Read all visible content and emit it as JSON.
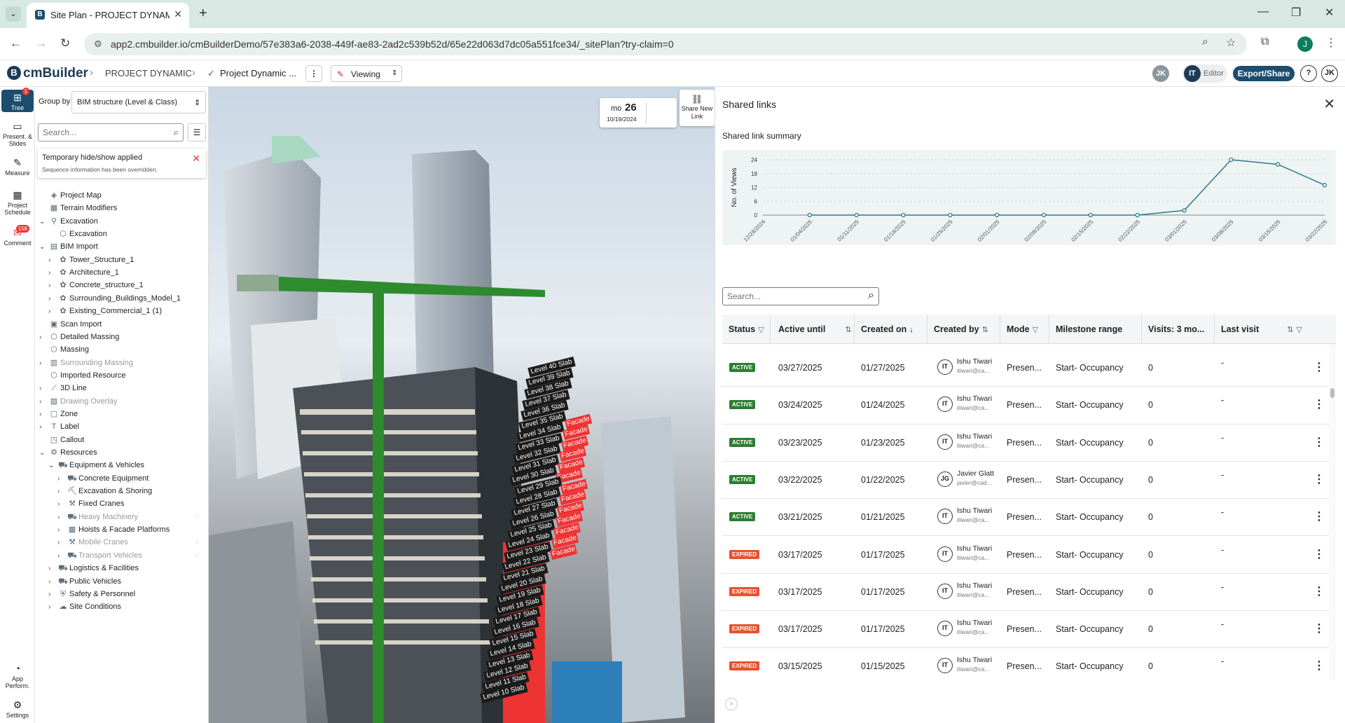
{
  "browser": {
    "tab_title": "Site Plan - PROJECT DYNAMIC",
    "url": "app2.cmbuilder.io/cmBuilderDemo/57e383a6-2038-449f-ae83-2ad2c539b52d/65e22d063d7dc05a551fce34/_sitePlan?try-claim=0",
    "profile_initial": "J"
  },
  "header": {
    "logo": "cmBuilder",
    "crumb1": "PROJECT DYNAMIC",
    "crumb2": "Project Dynamic ...",
    "mode": "Viewing",
    "user1": "JK",
    "editor_initials": "IT",
    "editor_label": "Editor",
    "export_label": "Export/Share",
    "help": "?",
    "user2": "JK"
  },
  "rail": {
    "tree": "Tree",
    "tree_badge": "1",
    "present": "Present. & Slides",
    "measure": "Measure",
    "schedule": "Project Schedule",
    "comment": "Comment",
    "comment_badge": "158",
    "perform": "App Perform.",
    "settings": "Settings"
  },
  "panel": {
    "group_by_label": "Group by",
    "group_by_value": "BIM structure (Level & Class)",
    "search_placeholder": "Search...",
    "notice_title": "Temporary hide/show applied",
    "notice_sub": "Sequence information has been overridden.",
    "tree": [
      {
        "label": "Project Map",
        "depth": 0,
        "chev": "",
        "icon": "◈"
      },
      {
        "label": "Terrain Modifiers",
        "depth": 0,
        "chev": "",
        "icon": "▦"
      },
      {
        "label": "Excavation",
        "depth": 0,
        "chev": "⌄",
        "icon": "⚲"
      },
      {
        "label": "Excavation",
        "depth": 1,
        "chev": "",
        "icon": "⬡"
      },
      {
        "label": "BIM Import",
        "depth": 0,
        "chev": "⌄",
        "icon": "▤"
      },
      {
        "label": "Tower_Structure_1",
        "depth": 1,
        "chev": "›",
        "icon": "✿"
      },
      {
        "label": "Architecture_1",
        "depth": 1,
        "chev": "›",
        "icon": "✿"
      },
      {
        "label": "Concrete_structure_1",
        "depth": 1,
        "chev": "›",
        "icon": "✿"
      },
      {
        "label": "Surrounding_Buildings_Model_1",
        "depth": 1,
        "chev": "›",
        "icon": "✿"
      },
      {
        "label": "Existing_Commercial_1 (1)",
        "depth": 1,
        "chev": "›",
        "icon": "✿"
      },
      {
        "label": "Scan Import",
        "depth": 0,
        "chev": "",
        "icon": "▣"
      },
      {
        "label": "Detailed Massing",
        "depth": 0,
        "chev": "›",
        "icon": "⬡"
      },
      {
        "label": "Massing",
        "depth": 0,
        "chev": "",
        "icon": "⬡"
      },
      {
        "label": "Surrounding Massing",
        "depth": 0,
        "chev": "›",
        "icon": "▥",
        "dim": true
      },
      {
        "label": "Imported Resource",
        "depth": 0,
        "chev": "",
        "icon": "⬡"
      },
      {
        "label": "3D Line",
        "depth": 0,
        "chev": "›",
        "icon": "⟋"
      },
      {
        "label": "Drawing Overlay",
        "depth": 0,
        "chev": "›",
        "icon": "▨",
        "dim": true
      },
      {
        "label": "Zone",
        "depth": 0,
        "chev": "›",
        "icon": "▢"
      },
      {
        "label": "Label",
        "depth": 0,
        "chev": "›",
        "icon": "T"
      },
      {
        "label": "Callout",
        "depth": 0,
        "chev": "",
        "icon": "◳"
      },
      {
        "label": "Resources",
        "depth": 0,
        "chev": "⌄",
        "icon": "⚙"
      },
      {
        "label": "Equipment & Vehicles",
        "depth": 1,
        "chev": "⌄",
        "icon": "⛟"
      },
      {
        "label": "Concrete Equipment",
        "depth": 2,
        "chev": "›",
        "icon": "⛟"
      },
      {
        "label": "Excavation & Shoring",
        "depth": 2,
        "chev": "›",
        "icon": "⛏"
      },
      {
        "label": "Fixed Cranes",
        "depth": 2,
        "chev": "›",
        "icon": "⚒"
      },
      {
        "label": "Heavy Machinery",
        "depth": 2,
        "chev": "›",
        "icon": "⛟",
        "dim": true,
        "eye": true
      },
      {
        "label": "Hoists & Facade Platforms",
        "depth": 2,
        "chev": "›",
        "icon": "▦"
      },
      {
        "label": "Mobile Cranes",
        "depth": 2,
        "chev": "›",
        "icon": "⚒",
        "dim": true,
        "eye": true
      },
      {
        "label": "Transport Vehicles",
        "depth": 2,
        "chev": "›",
        "icon": "⛟",
        "dim": true,
        "eye": true
      },
      {
        "label": "Logistics & Facilities",
        "depth": 1,
        "chev": "›",
        "icon": "⛟"
      },
      {
        "label": "Public Vehicles",
        "depth": 1,
        "chev": "›",
        "icon": "⛟"
      },
      {
        "label": "Safety & Personnel",
        "depth": 1,
        "chev": "›",
        "icon": "⛨"
      },
      {
        "label": "Site Conditions",
        "depth": 1,
        "chev": "›",
        "icon": "☁"
      }
    ]
  },
  "viewport": {
    "date_mode": "mo",
    "date_day": "26",
    "date_full": "10/19/2024",
    "share_label": "Share New Link",
    "level_labels": [
      "Level 40 Slab",
      "Level 39 Slab",
      "Level 38 Slab",
      "Level 37 Slab",
      "Level 36 Slab",
      "Level 35 Slab",
      "Level 34 Slab",
      "Level 33 Slab",
      "Level 32 Slab",
      "Level 31 Slab",
      "Level 30 Slab",
      "Level 29 Slab",
      "Level 28 Slab",
      "Level 27 Slab",
      "Level 26 Slab",
      "Level 25 Slab",
      "Level 24 Slab",
      "Level 23 Slab",
      "Level 22 Slab",
      "Level 21 Slab",
      "Level 20 Slab",
      "Level 19 Slab",
      "Level 18 Slab",
      "Level 17 Slab",
      "Level 16 Slab",
      "Level 15 Slab",
      "Level 14 Slab",
      "Level 13 Slab",
      "Level 12 Slab",
      "Level 11 Slab",
      "Level 10 Slab"
    ],
    "facade_label": "Facade"
  },
  "shared": {
    "title": "Shared links",
    "summary_label": "Shared link summary",
    "search_placeholder": "Search...",
    "columns": [
      "Status",
      "Active until",
      "Created on",
      "Created by",
      "Mode",
      "Milestone range",
      "Visits: 3 mo...",
      "Last visit"
    ],
    "rows": [
      {
        "status": "ACTIVE",
        "until": "03/27/2025",
        "created": "01/27/2025",
        "initials": "IT",
        "name": "Ishu Tiwari",
        "email": "itiwari@ca...",
        "mode": "Presen...",
        "range": "Start- Occupancy",
        "visits": "0",
        "last": "-"
      },
      {
        "status": "ACTIVE",
        "until": "03/24/2025",
        "created": "01/24/2025",
        "initials": "IT",
        "name": "Ishu Tiwari",
        "email": "itiwari@ca...",
        "mode": "Presen...",
        "range": "Start- Occupancy",
        "visits": "0",
        "last": "-"
      },
      {
        "status": "ACTIVE",
        "until": "03/23/2025",
        "created": "01/23/2025",
        "initials": "IT",
        "name": "Ishu Tiwari",
        "email": "itiwari@ca...",
        "mode": "Presen...",
        "range": "Start- Occupancy",
        "visits": "0",
        "last": "-"
      },
      {
        "status": "ACTIVE",
        "until": "03/22/2025",
        "created": "01/22/2025",
        "initials": "JG",
        "name": "Javier Glatt",
        "email": "javier@cad...",
        "mode": "Presen...",
        "range": "Start- Occupancy",
        "visits": "0",
        "last": "-"
      },
      {
        "status": "ACTIVE",
        "until": "03/21/2025",
        "created": "01/21/2025",
        "initials": "IT",
        "name": "Ishu Tiwari",
        "email": "itiwari@ca...",
        "mode": "Presen...",
        "range": "Start- Occupancy",
        "visits": "0",
        "last": "-"
      },
      {
        "status": "EXPIRED",
        "until": "03/17/2025",
        "created": "01/17/2025",
        "initials": "IT",
        "name": "Ishu Tiwari",
        "email": "itiwari@ca...",
        "mode": "Presen...",
        "range": "Start- Occupancy",
        "visits": "0",
        "last": "-"
      },
      {
        "status": "EXPIRED",
        "until": "03/17/2025",
        "created": "01/17/2025",
        "initials": "IT",
        "name": "Ishu Tiwari",
        "email": "itiwari@ca...",
        "mode": "Presen...",
        "range": "Start- Occupancy",
        "visits": "0",
        "last": "-"
      },
      {
        "status": "EXPIRED",
        "until": "03/17/2025",
        "created": "01/17/2025",
        "initials": "IT",
        "name": "Ishu Tiwari",
        "email": "itiwari@ca...",
        "mode": "Presen...",
        "range": "Start- Occupancy",
        "visits": "0",
        "last": "-"
      },
      {
        "status": "EXPIRED",
        "until": "03/15/2025",
        "created": "01/15/2025",
        "initials": "IT",
        "name": "Ishu Tiwari",
        "email": "itiwari@ca...",
        "mode": "Presen...",
        "range": "Start- Occupancy",
        "visits": "0",
        "last": "-"
      }
    ]
  },
  "chart_data": {
    "type": "line",
    "ylabel": "No. of Views",
    "x": [
      "12/28/2024",
      "01/04/2025",
      "01/11/2025",
      "01/18/2025",
      "01/25/2025",
      "02/01/2025",
      "02/08/2025",
      "02/15/2025",
      "02/22/2025",
      "03/01/2025",
      "03/08/2025",
      "03/15/2025",
      "03/22/2025"
    ],
    "values": [
      null,
      0,
      0,
      0,
      0,
      0,
      0,
      0,
      0,
      2,
      24,
      22,
      13
    ],
    "yticks": [
      0,
      6,
      12,
      18,
      24
    ],
    "ylim": [
      0,
      24
    ],
    "grid": true,
    "color": "#2b7a8c"
  },
  "colors": {
    "brand": "#1d4d6e",
    "active": "#2e7d32",
    "expired": "#e8522e"
  }
}
